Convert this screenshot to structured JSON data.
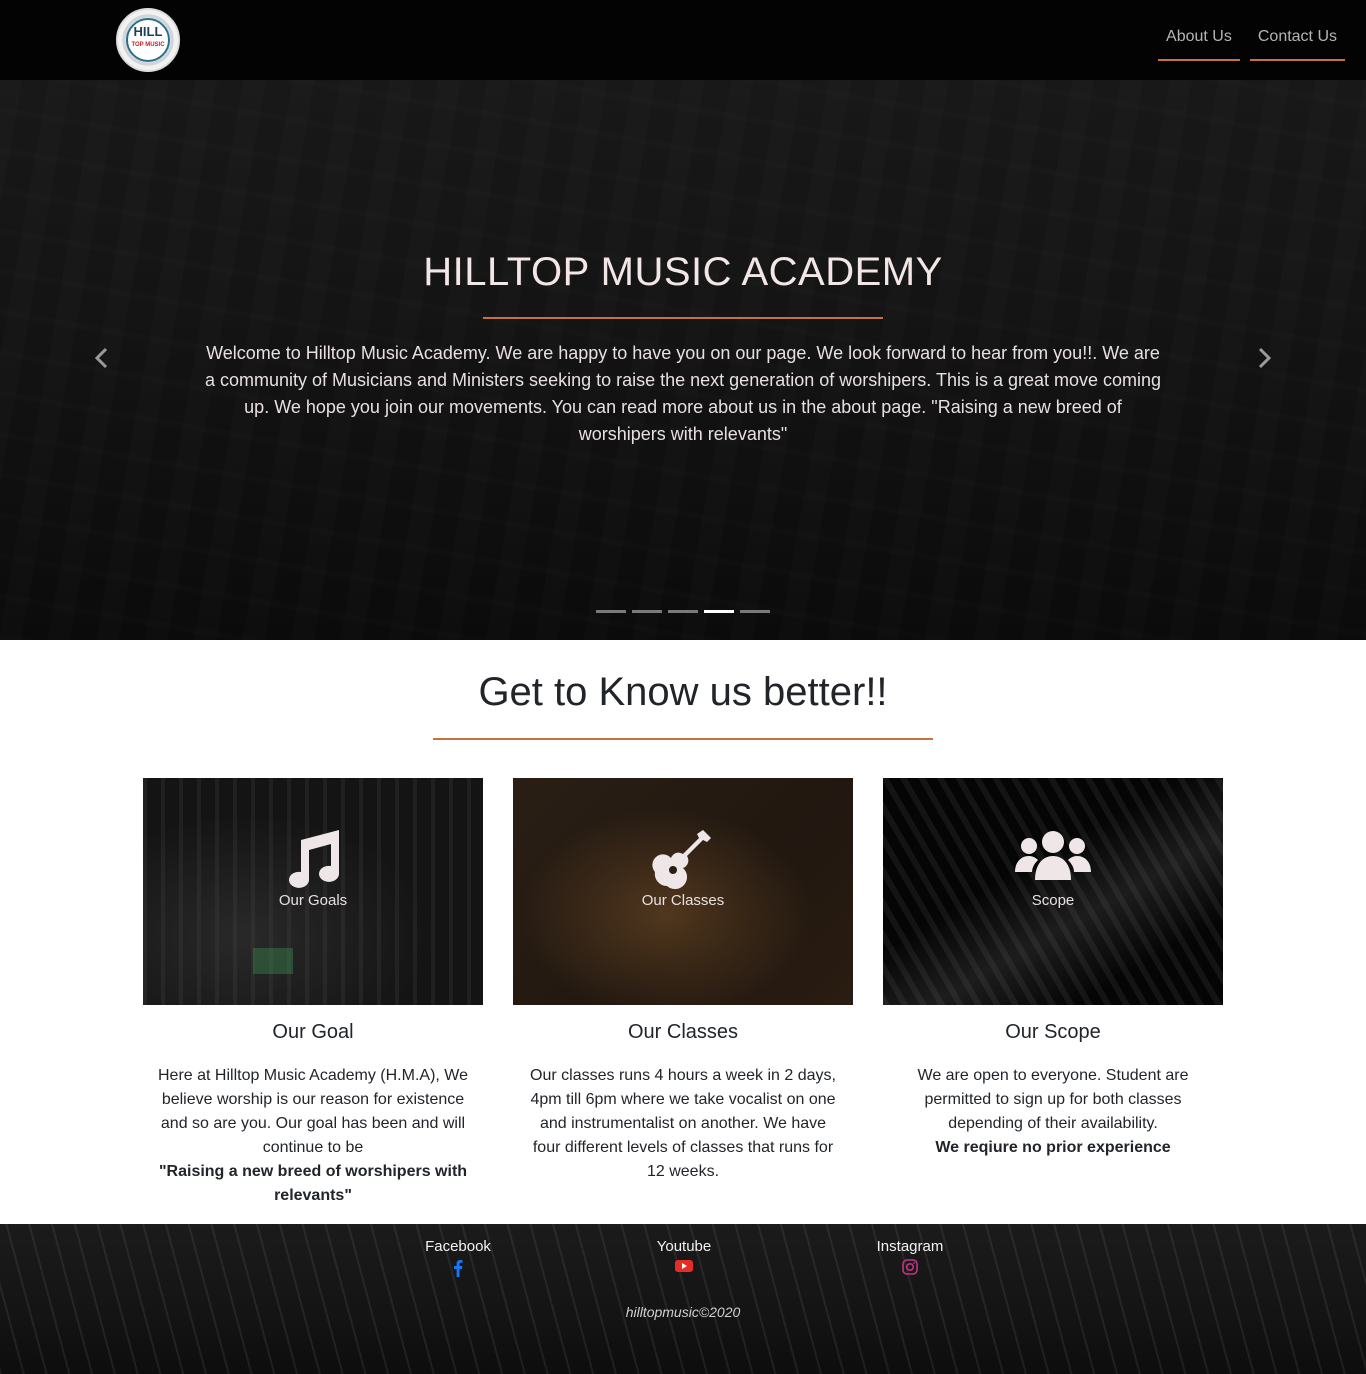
{
  "navbar": {
    "logo": {
      "main_text": "HILL",
      "sub_text": "TOP MUSIC"
    },
    "links": [
      {
        "label": "About Us"
      },
      {
        "label": "Contact Us"
      }
    ],
    "accent_color": "#c8713d"
  },
  "hero": {
    "title": "HILLTOP MUSIC ACADEMY",
    "text": "Welcome to Hilltop Music Academy. We are happy to have you on our page. We look forward to hear from you!!. We are a community of Musicians and Ministers seeking to raise the next generation of worshipers. This is a great move coming up. We hope you join our movements. You can read more about us in the about page. \"Raising a new breed of worshipers with relevants\"",
    "prev_icon": "chevron-left-icon",
    "next_icon": "chevron-right-icon",
    "slides_count": 5,
    "active_slide": 4
  },
  "about": {
    "title": "Get to Know us better!!",
    "cards": [
      {
        "icon": "music-note-icon",
        "image_label": "Our Goals",
        "heading": "Our Goal",
        "text": "Here at Hilltop Music Academy (H.M.A), We believe worship is our reason for existence and so are you. Our goal has been and will continue to be",
        "bold": "\"Raising a new breed of worshipers with relevants\""
      },
      {
        "icon": "guitar-icon",
        "image_label": "Our Classes",
        "heading": "Our Classes",
        "text": "Our classes runs 4 hours a week in 2 days, 4pm till 6pm where we take vocalist on one and instrumentalist on another. We have four different levels of classes that runs for 12 weeks.",
        "bold": ""
      },
      {
        "icon": "users-icon",
        "image_label": "Scope",
        "heading": "Our Scope",
        "text": "We are open to everyone. Student are permitted to sign up for both classes depending of their availability.",
        "bold": "We reqiure no prior experience"
      }
    ]
  },
  "footer": {
    "social": [
      {
        "label": "Facebook",
        "icon": "facebook-icon",
        "color": "#1877f2"
      },
      {
        "label": "Youtube",
        "icon": "youtube-icon",
        "color": "#e52d27"
      },
      {
        "label": "Instagram",
        "icon": "instagram-icon",
        "color": "#c13584"
      }
    ],
    "copyright": "hilltopmusic©2020"
  }
}
